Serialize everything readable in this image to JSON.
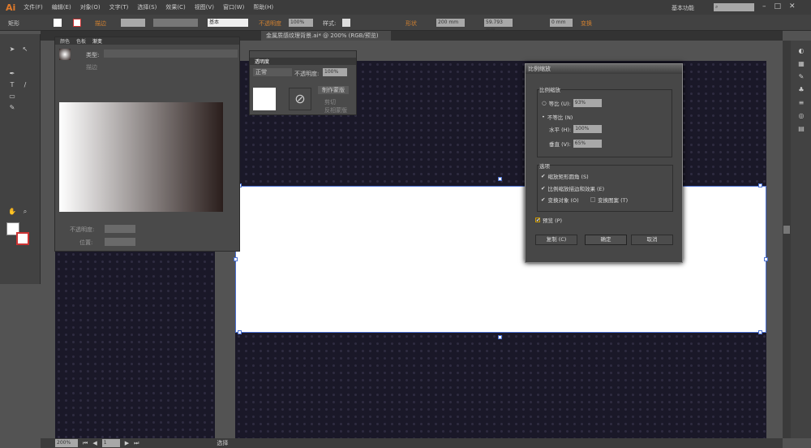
{
  "app": {
    "logo": "Ai",
    "menus": [
      "文件(F)",
      "编辑(E)",
      "对象(O)",
      "文字(T)",
      "选择(S)",
      "效果(C)",
      "视图(V)",
      "窗口(W)",
      "帮助(H)"
    ],
    "workspace": "基本功能",
    "search_icon": "search-icon"
  },
  "control": {
    "object_type": "矩形",
    "stroke_label": "描边",
    "stroke_style": "基本",
    "opacity_label": "不透明度",
    "opacity_value": "100%",
    "style_label": "样式:",
    "shape_label": "形状",
    "width": "200 mm",
    "height": "59.793 mm",
    "corner": "0 mm",
    "transform_label": "变换"
  },
  "document_tab": {
    "title": "金属质感纹理背景.ai* @ 200% (RGB/预览)"
  },
  "gradient_panel": {
    "tabs": [
      "颜色",
      "色板",
      "渐变"
    ],
    "active_tab": "渐变",
    "type_label": "类型:",
    "stroke_label": "描边",
    "opacity_label": "不透明度:",
    "location_label": "位置:",
    "gradient_start": "#ffffff",
    "gradient_end": "#2a1e1c"
  },
  "transparency_panel": {
    "title": "透明度",
    "blend_mode": "正常",
    "opacity_label": "不透明度:",
    "opacity_value": "100%",
    "make_mask": "制作蒙版",
    "clip": "剪切",
    "invert_mask": "反相蒙版"
  },
  "dialog": {
    "title": "比例缩放",
    "scale_group": "比例缩放",
    "uniform_label": "等比 (U):",
    "uniform_value": "93%",
    "uniform_selected": false,
    "nonuniform_label": "不等比 (N)",
    "nonuniform_selected": true,
    "horizontal_label": "水平 (H):",
    "horizontal_value": "100%",
    "vertical_label": "垂直 (V):",
    "vertical_value": "65%",
    "options_group": "选项",
    "scale_corners": {
      "label": "缩放矩形圆角 (S)",
      "checked": true
    },
    "scale_strokes": {
      "label": "比例缩放描边和效果 (E)",
      "checked": true
    },
    "transform_objects": {
      "label": "变换对象 (O)",
      "checked": true
    },
    "transform_patterns": {
      "label": "变换图案 (T)",
      "checked": false
    },
    "preview": {
      "label": "预览 (P)",
      "checked": true
    },
    "copy": "复制 (C)",
    "ok": "确定",
    "cancel": "取消"
  },
  "status": {
    "zoom": "200%",
    "artboard": "1",
    "tool": "选择"
  }
}
